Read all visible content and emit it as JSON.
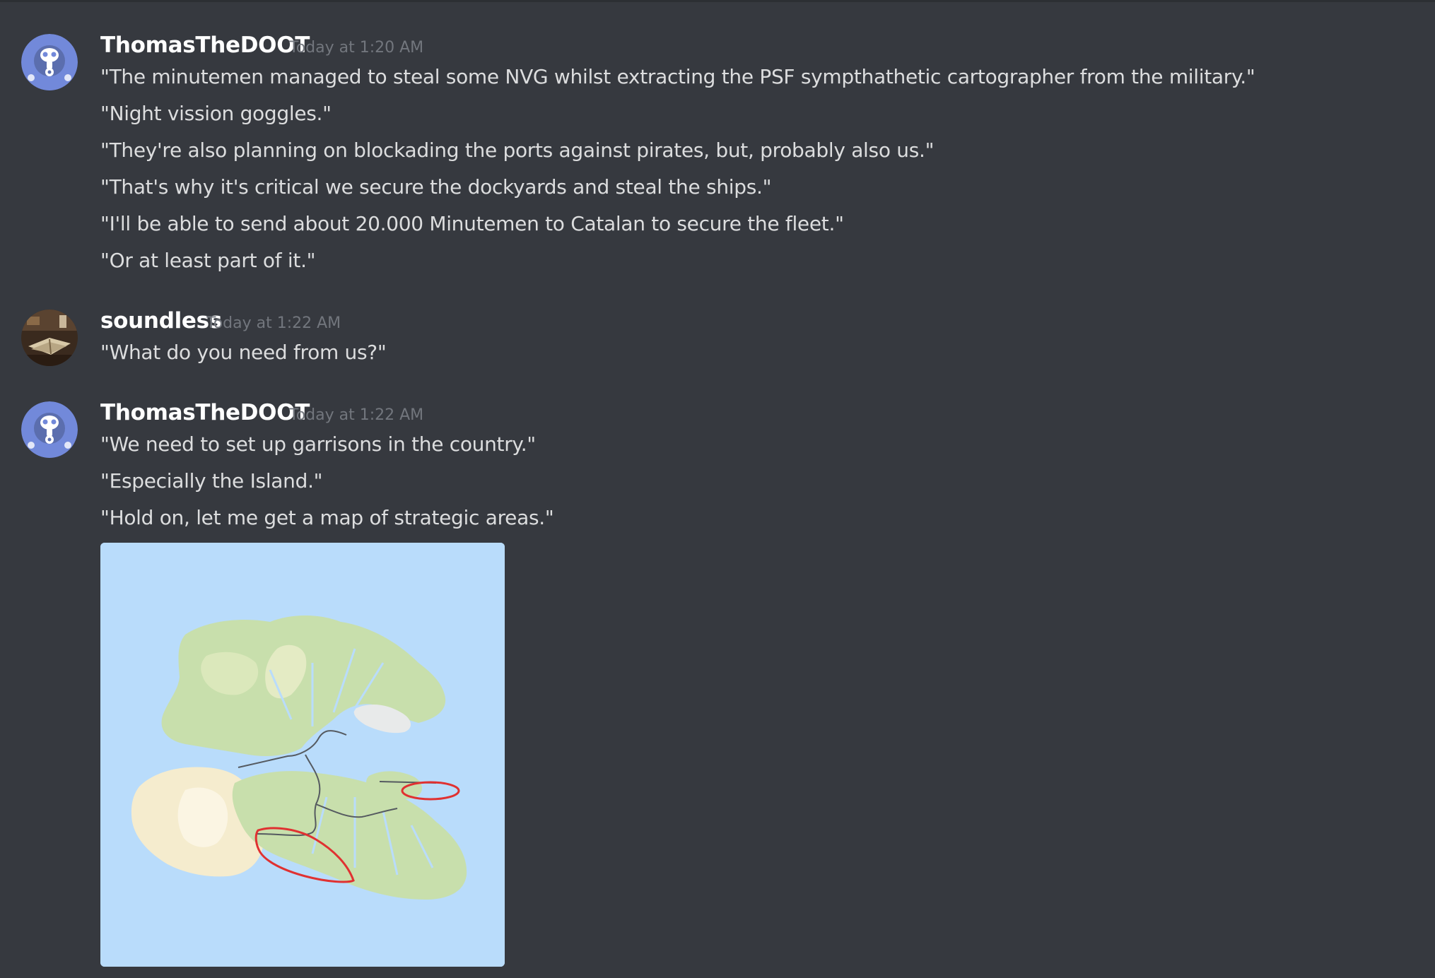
{
  "messages": [
    {
      "author": "ThomasTheDOOT",
      "timestamp": "Today at 1:20 AM",
      "avatar_icon": "gas-mask-avatar-icon",
      "lines": [
        "\"The minutemen managed to steal some NVG whilst extracting the PSF sympthathetic cartographer from the military.\"",
        "\"Night vission goggles.\"",
        "\"They're also planning on blockading the ports against pirates, but, probably also us.\"",
        "\"That's why it's critical we secure the dockyards and steal the ships.\"",
        "\"I'll be able to send about 20.000 Minutemen to Catalan to secure the fleet.\"",
        "\"Or at least part of it.\""
      ]
    },
    {
      "author": "soundless",
      "timestamp": "Today at 1:22 AM",
      "avatar_icon": "books-photo-avatar-icon",
      "lines": [
        "\"What do you need from us?\""
      ]
    },
    {
      "author": "ThomasTheDOOT",
      "timestamp": "Today at 1:22 AM",
      "avatar_icon": "gas-mask-avatar-icon",
      "lines": [
        "\"We need to set up garrisons in the country.\"",
        "\"Especially the Island.\"",
        "\"Hold on, let me get a map of strategic areas.\""
      ],
      "attachment": {
        "type": "image",
        "description_icon": "island-map-image",
        "annotation_color": "#e03131"
      }
    }
  ],
  "colors": {
    "background": "#36393f",
    "username": "#ffffff",
    "message_text": "#dcddde",
    "timestamp": "#72767d",
    "avatar_blue": "#7289da"
  }
}
